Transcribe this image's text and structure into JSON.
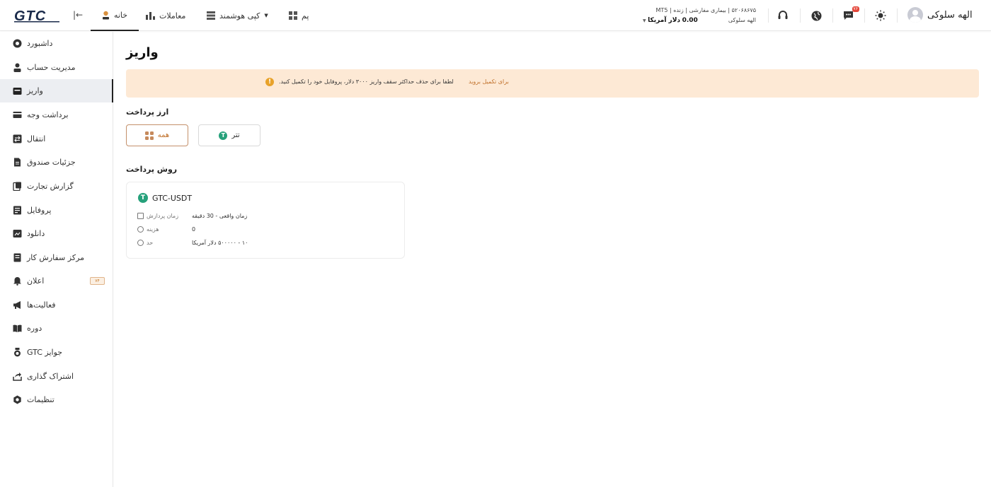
{
  "header": {
    "logo_text": "GTC",
    "nav": {
      "home": "خانه",
      "trades": "معاملات",
      "smart_copy": "کپی هوشمند",
      "pam": "پم"
    },
    "account": {
      "number": "۵۲۰۶۸۶۷۵",
      "type": "بیماری مفارشی",
      "mode": "زنده",
      "platform": "MT5",
      "balance": "0.00",
      "currency": "دلار آمریکا",
      "holder": "الهه سلوکی"
    },
    "notifications_badge": "۷۶",
    "user_name": "الهه سلوکی"
  },
  "sidebar": {
    "items": [
      {
        "label": "داشبورد",
        "icon": "dashboard-icon"
      },
      {
        "label": "مدیریت حساب",
        "icon": "user-icon"
      },
      {
        "label": "واریز",
        "icon": "wallet-icon"
      },
      {
        "label": "برداشت وجه",
        "icon": "card-icon"
      },
      {
        "label": "انتقال",
        "icon": "transfer-icon"
      },
      {
        "label": "جزئیات صندوق",
        "icon": "document-icon"
      },
      {
        "label": "گزارش تجارت",
        "icon": "report-icon"
      },
      {
        "label": "پروفایل",
        "icon": "profile-icon"
      },
      {
        "label": "دانلود",
        "icon": "download-icon"
      },
      {
        "label": "مرکز سفارش کار",
        "icon": "order-icon"
      },
      {
        "label": "اعلان",
        "icon": "bell-icon"
      },
      {
        "label": "فعالیت‌ها",
        "icon": "megaphone-icon"
      },
      {
        "label": "دوره",
        "icon": "book-icon"
      },
      {
        "label": "جوایز GTC",
        "icon": "medal-icon"
      },
      {
        "label": "اشتراک گذاری",
        "icon": "share-icon"
      },
      {
        "label": "تنظیمات",
        "icon": "settings-icon"
      }
    ],
    "notification_badge": "۷۴"
  },
  "main": {
    "title": "واریز",
    "alert": {
      "message": "لطفا برای حذف حداکثر سقف واریز ۳۰۰۰ دلار، پروفایل خود را تکمیل کنید.",
      "link": "برای تکمیل بروید"
    },
    "currency_section": "ارز پرداخت",
    "currencies": {
      "all": "همه",
      "tether": "تتر"
    },
    "method_section": "روش پرداخت",
    "method": {
      "name": "GTC-USDT",
      "processing_label": "زمان پردازش",
      "processing_value": "زمان واقعی - 30 دقیقه",
      "fee_label": "هزینه",
      "fee_value": "0",
      "limit_label": "حد",
      "limit_value": "۱۰ - ۵۰۰۰۰۰ دلار آمریکا"
    }
  },
  "colors": {
    "accent": "#c0712b",
    "alert_bg": "#fde9d5",
    "tether": "#26a17b",
    "badge": "#e4473a"
  }
}
